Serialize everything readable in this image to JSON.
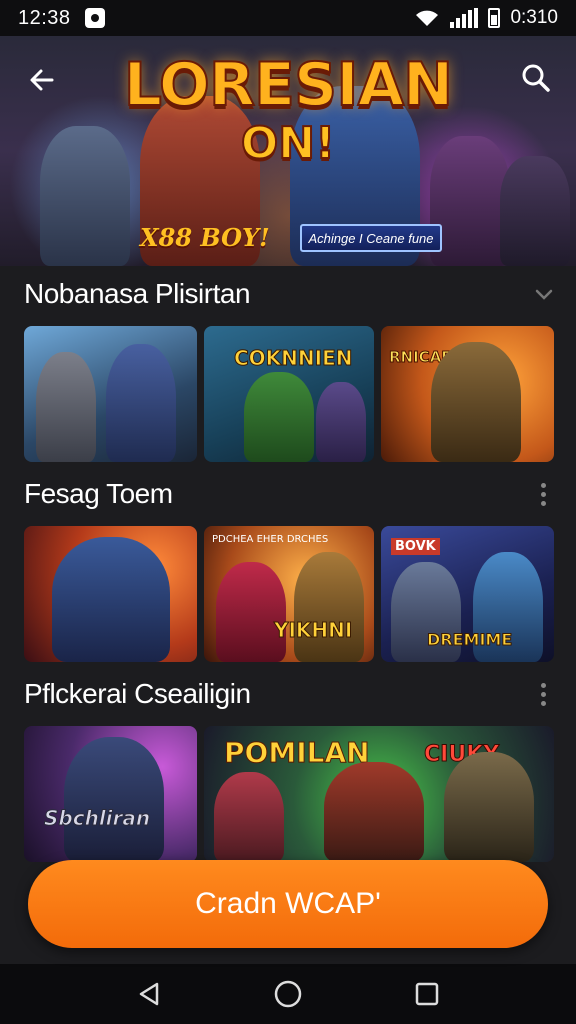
{
  "status_bar": {
    "time": "12:38",
    "battery_text": "0:310"
  },
  "hero": {
    "title": "LORESIAN",
    "subtitle": "ON!",
    "tagline": "X88 BOY!",
    "banner": "Achinge I Ceane fune",
    "colors": {
      "title": "#ffb21e",
      "outline": "#6a1b06"
    }
  },
  "sections": [
    {
      "title": "Nobanasa Plisirtan",
      "cards": [
        {
          "label": ""
        },
        {
          "label": "COKNNIEN"
        },
        {
          "label": "RNICAE"
        }
      ]
    },
    {
      "title": "Fesag Toem",
      "cards": [
        {
          "label": ""
        },
        {
          "label": "PDCHEA EHER DRCHES",
          "label2": "YIKHNI"
        },
        {
          "label": "BOVK",
          "label2": "DREMIME"
        }
      ]
    },
    {
      "title": "Pflckerai Cseailigin",
      "cards": [
        {
          "label": "Sbchliran"
        },
        {
          "label": "POMILAN",
          "label2": "CIUKY"
        }
      ]
    }
  ],
  "cta": {
    "label": "Cradn WCAP'",
    "color": "#f57a12"
  },
  "nav": {
    "back": "back-icon",
    "home": "home-icon",
    "recents": "recents-icon"
  }
}
